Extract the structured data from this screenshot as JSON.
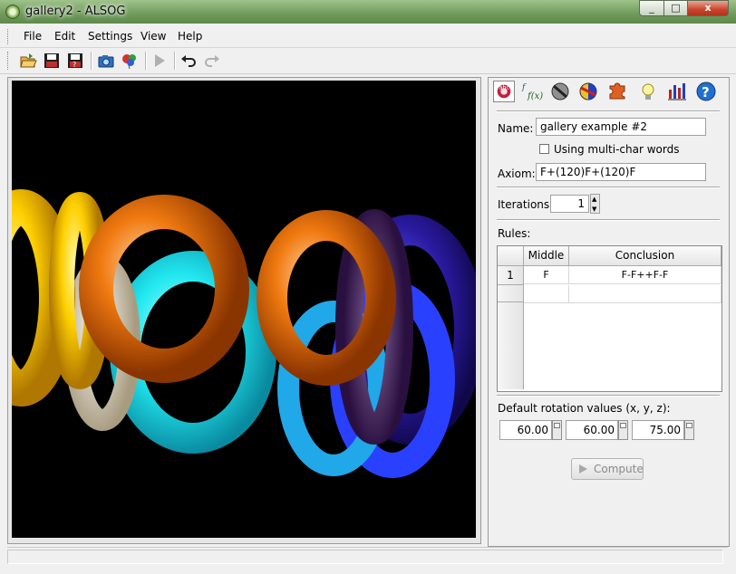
{
  "window": {
    "title": "gallery2 - ALSOG",
    "minimize": "_",
    "maximize": "□",
    "close": "x"
  },
  "menu": [
    {
      "label": "File"
    },
    {
      "label": "Edit"
    },
    {
      "label": "Settings"
    },
    {
      "label": "View"
    },
    {
      "label": "Help"
    }
  ],
  "toolbar": {
    "icons": [
      "open-folder-icon",
      "save-icon",
      "save-as-icon",
      "camera-icon",
      "export-balloons-icon",
      "play-icon",
      "undo-icon",
      "redo-icon"
    ]
  },
  "panel": {
    "tabs": [
      "lsystem-icon",
      "function-icon",
      "material-icon",
      "color-icon",
      "puzzle-icon",
      "light-bulb-icon",
      "statistics-icon",
      "help-icon"
    ],
    "name_label": "Name:",
    "name_value": "gallery example #2",
    "multichar_label": "Using multi-char words",
    "multichar_checked": false,
    "axiom_label": "Axiom:",
    "axiom_value": "F+(120)F+(120)F",
    "iterations_label": "Iterations:",
    "iterations_value": "1",
    "rules_label": "Rules:",
    "rules_columns": [
      "Middle",
      "Conclusion"
    ],
    "rules": [
      {
        "row": "1",
        "middle": "F",
        "conclusion": "F-F++F-F"
      }
    ],
    "rotation_label": "Default rotation values (x, y, z):",
    "rotation": {
      "x": "60.00",
      "y": "60.00",
      "z": "75.00"
    },
    "compute_label": "Compute"
  },
  "colors": {
    "background": "#000000",
    "yellow": "#ffd400",
    "orange": "#f07a10",
    "cyan": "#22e8f0",
    "purple": "#4a2a8a",
    "blue": "#2040ff"
  }
}
